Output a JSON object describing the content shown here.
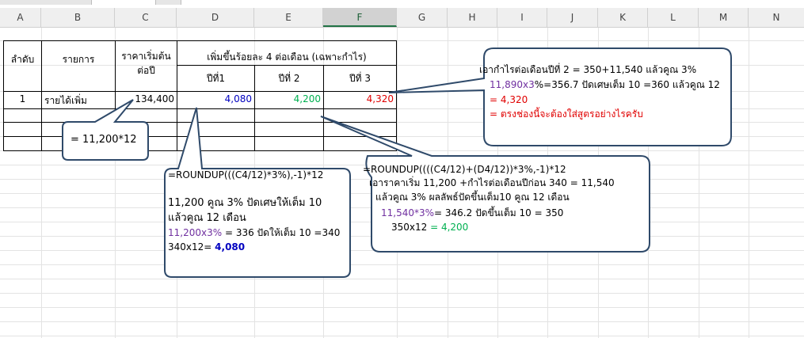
{
  "columns": [
    "A",
    "B",
    "C",
    "D",
    "E",
    "F",
    "G",
    "H",
    "I",
    "J",
    "K",
    "L",
    "M",
    "N"
  ],
  "table": {
    "col_a_header": "ลำดับ",
    "col_b_header": "รายการ",
    "col_c_header_line1": "ราคาเริ่มต้น",
    "col_c_header_line2": "ต่อปี",
    "group_header": "เพิ่มขึ้นร้อยละ 4 ต่อเดือน (เฉพาะกำไร)",
    "year1": "ปีที่1",
    "year2": "ปีที่ 2",
    "year3": "ปีที่ 3",
    "row_no": "1",
    "row_item": "รายได้เพิ่ม",
    "row_start_price": "134,400",
    "row_year1": "4,080",
    "row_year2": "4,200",
    "row_year3": "4,320"
  },
  "callouts": {
    "c_formula": "= 11,200*12",
    "d_formula": "=ROUNDUP(((C4/12)*3%),-1)*12",
    "d_line1": "11,200 คูณ 3% ปัดเศษให้เต็ม 10",
    "d_line2": "แล้วคูณ 12 เดือน",
    "d_line3_a": "11,200x3%",
    "d_line3_b": " = 336 ปัดให้เต็ม 10 =340",
    "d_line4_a": "340x12= ",
    "d_line4_b": "4,080",
    "e_formula": "=ROUNDUP((((C4/12)+(D4/12))*3%,-1)*12",
    "e_line1": "เอาราคาเริ่ม 11,200 +กำไรต่อเดือนปีก่อน 340 = 11,540",
    "e_line2": "แล้วคูณ 3% ผลลัพธ์ปัดขึ้นเต็ม10 คูณ 12 เดือน",
    "e_line3_a": "11,540*3%",
    "e_line3_b": "= 346.2 ปัดขึ้นเต็ม 10 = 350",
    "e_line4_a": "350x12 ",
    "e_line4_b": "= 4,200",
    "f_line1": "เอากำไรต่อเดือนปีที่ 2 = 350+11,540 แล้วคูณ 3%",
    "f_line2_a": "11,890x3",
    "f_line2_b": "%=356.7 ปัดเศษเต็ม 10 =360 แล้วคูณ 12",
    "f_line3": "= 4,320",
    "f_line4": "= ตรงช่องนี้จะต้องใส่สูตรอย่างไรครับ"
  },
  "colors": {
    "accent_green": "#217346",
    "purple": "#7030a0",
    "blue": "#0000c0",
    "green": "#00b050",
    "red": "#e00000",
    "callout_border": "#2f4a6a"
  }
}
